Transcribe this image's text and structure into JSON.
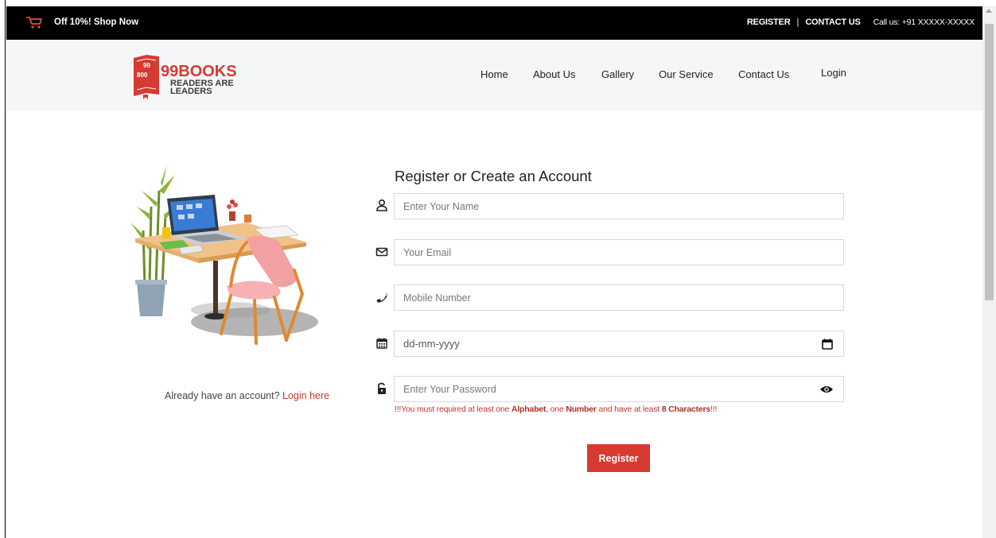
{
  "topbar": {
    "promo": "Off 10%! Shop Now",
    "register": "REGISTER",
    "separator": "|",
    "contact": "CONTACT US",
    "call": "Call us: +91 XXXXX-XXXXX",
    "cart_icon": "cart-icon"
  },
  "logo": {
    "brand": "99BOOKS",
    "tag1": "READERS ARE",
    "tag2": "LEADERS",
    "badge_top": "99",
    "badge_bottom": "800"
  },
  "nav": {
    "items": [
      "Home",
      "About Us",
      "Gallery",
      "Our Service",
      "Contact Us",
      "Login"
    ]
  },
  "illustration": {
    "caption": "Already have an account?",
    "login_link": "Login here"
  },
  "form": {
    "title": "Register or Create an Account",
    "fields": [
      {
        "icon": "user-icon",
        "placeholder": "Enter Your Name"
      },
      {
        "icon": "envelope-icon",
        "placeholder": "Your Email"
      },
      {
        "icon": "phone-icon",
        "placeholder": "Mobile Number"
      },
      {
        "icon": "calendar-icon",
        "placeholder": "dd-mm-yyyy"
      },
      {
        "icon": "lock-icon",
        "placeholder": "Enter Your Password"
      }
    ],
    "warning": {
      "p1": "!!!You must required at least one ",
      "alpha": "Alphabet",
      "p2": ", one ",
      "number": "Number",
      "p3": " and have at least ",
      "chars": "8 Characters",
      "p4": "!!!"
    },
    "submit": "Register"
  },
  "colors": {
    "accent": "#d63a31",
    "topbar": "#000000",
    "header_bg": "#f5f6f8"
  }
}
